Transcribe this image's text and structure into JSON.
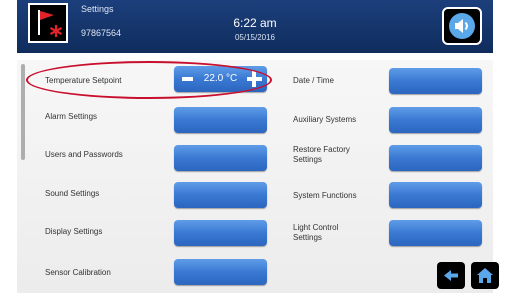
{
  "header": {
    "title": "Settings",
    "id": "97867564",
    "time": "6:22 am",
    "date": "05/15/2016",
    "icons": {
      "device": "flag-alarm-icon",
      "sound": "speaker-icon"
    }
  },
  "setpoint": {
    "label": "Temperature Setpoint",
    "value": "22.0 °C"
  },
  "left_items": [
    {
      "label": "Alarm Settings"
    },
    {
      "label": "Users and Passwords"
    },
    {
      "label": "Sound Settings"
    },
    {
      "label": "Display Settings"
    },
    {
      "label": "Sensor Calibration"
    }
  ],
  "right_items": [
    {
      "label": "Date / Time"
    },
    {
      "label": "Auxiliary Systems"
    },
    {
      "label": "Restore Factory\nSettings"
    },
    {
      "label": "System Functions"
    },
    {
      "label": "Light Control\nSettings"
    }
  ],
  "nav": {
    "back_icon": "back-arrow-icon",
    "home_icon": "home-icon"
  },
  "colors": {
    "header": "#1c3f7c",
    "button": "#3a79d3",
    "highlight": "#c8102e"
  }
}
